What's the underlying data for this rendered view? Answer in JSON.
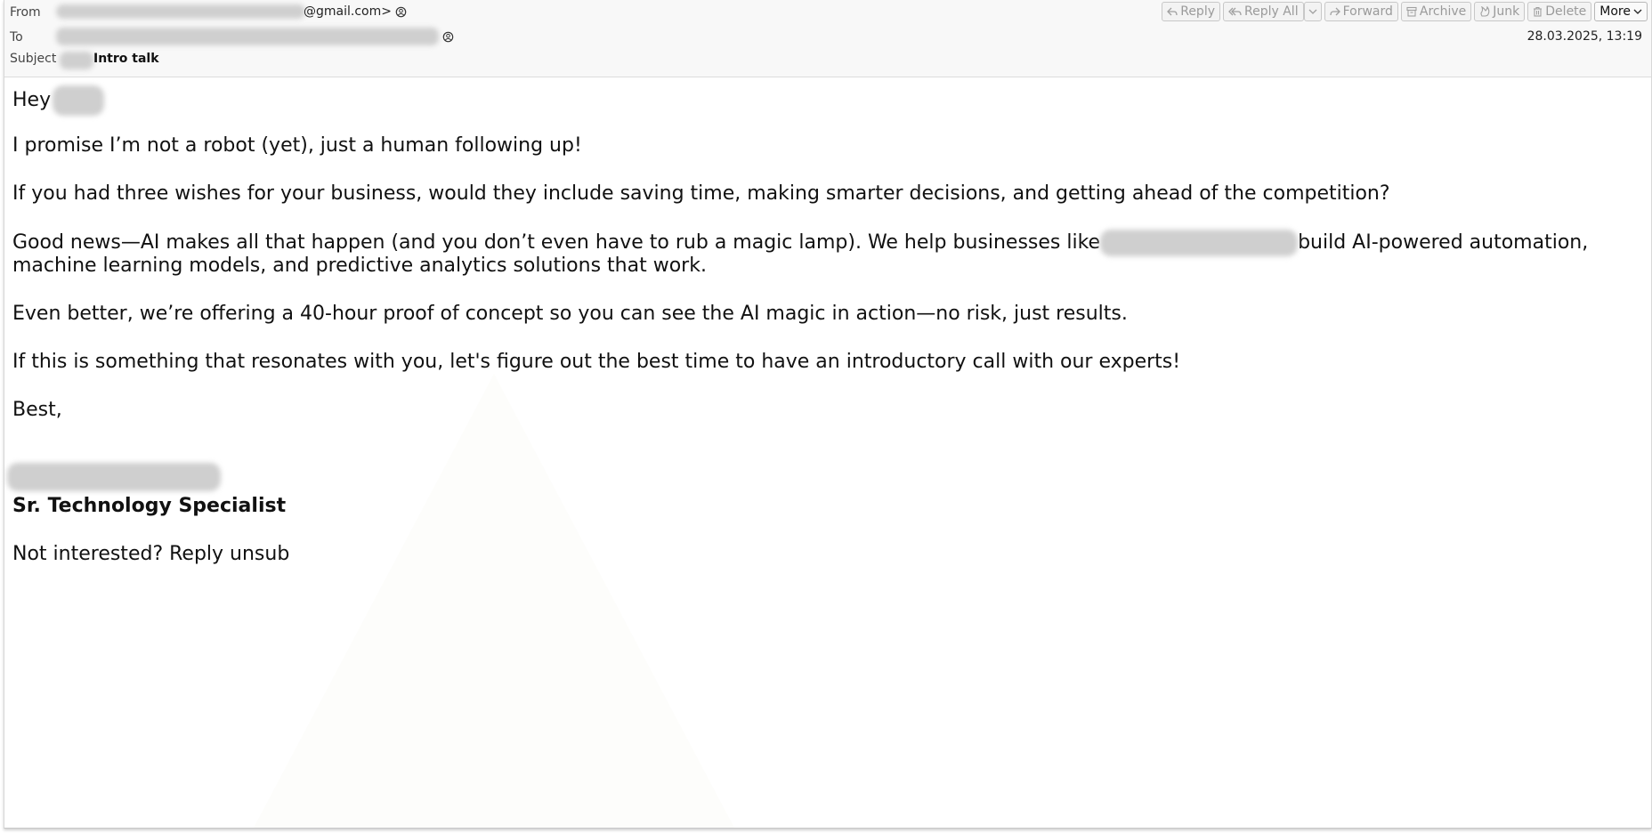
{
  "header": {
    "from_label": "From",
    "from_suffix": "@gmail.com>",
    "to_label": "To",
    "subject_label": "Subject",
    "subject": "Intro talk",
    "date": "28.03.2025, 13:19"
  },
  "toolbar": {
    "reply": "Reply",
    "reply_all": "Reply All",
    "forward": "Forward",
    "archive": "Archive",
    "junk": "Junk",
    "delete": "Delete",
    "more": "More"
  },
  "body": {
    "greeting": "Hey",
    "p1": "I promise I’m not a robot (yet), just a human following up!",
    "p2": "If you had three wishes for your business, would they include saving time, making smarter decisions, and getting ahead of the competition?",
    "p3_a": "Good news—AI makes all that happen (and you don’t even have to rub a magic lamp). We help businesses like",
    "p3_b": "build AI-powered automation,",
    "p3_c": "machine learning models, and predictive analytics solutions that work.",
    "p4": "Even better, we’re offering a 40-hour proof of concept so you can see the AI magic in action—no risk, just results.",
    "p5": "If this is something that resonates with you, let's figure out the best time to have an introductory call with our experts!",
    "signoff": "Best,",
    "title": "Sr. Technology Specialist",
    "unsub": "Not interested? Reply unsub"
  }
}
